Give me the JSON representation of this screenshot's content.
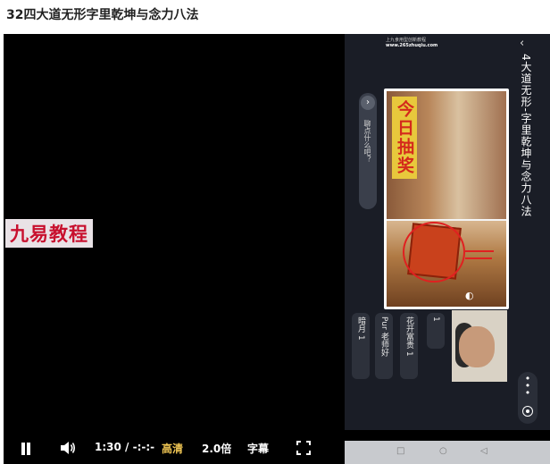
{
  "page": {
    "title": "32四大道无形字里乾坤与念力八法"
  },
  "player": {
    "watermark": "九易教程",
    "controls": {
      "current_time": "1:30",
      "separator": "/",
      "duration": "-:-:-",
      "quality_label": "高清",
      "speed_label": "2.0倍",
      "subtitle_label": "字幕"
    }
  },
  "phone": {
    "site_line1": "上九食用型创新教程",
    "site_line2": "www.265zhuqiu.com",
    "lesson_title": "4大道无形-字里乾坤与念力八法",
    "chat_prompt": "聊点什么吧？",
    "lottery_banner": "今日抽奖",
    "messages": [
      {
        "text": "花开富贵 1"
      },
      {
        "text": "Pur 老师好"
      },
      {
        "text": "1"
      },
      {
        "text": "暗月 1"
      }
    ]
  },
  "colors": {
    "quality_accent": "#f0c654",
    "watermark_red": "#c8102e",
    "lottery_red": "#d42a1c"
  }
}
